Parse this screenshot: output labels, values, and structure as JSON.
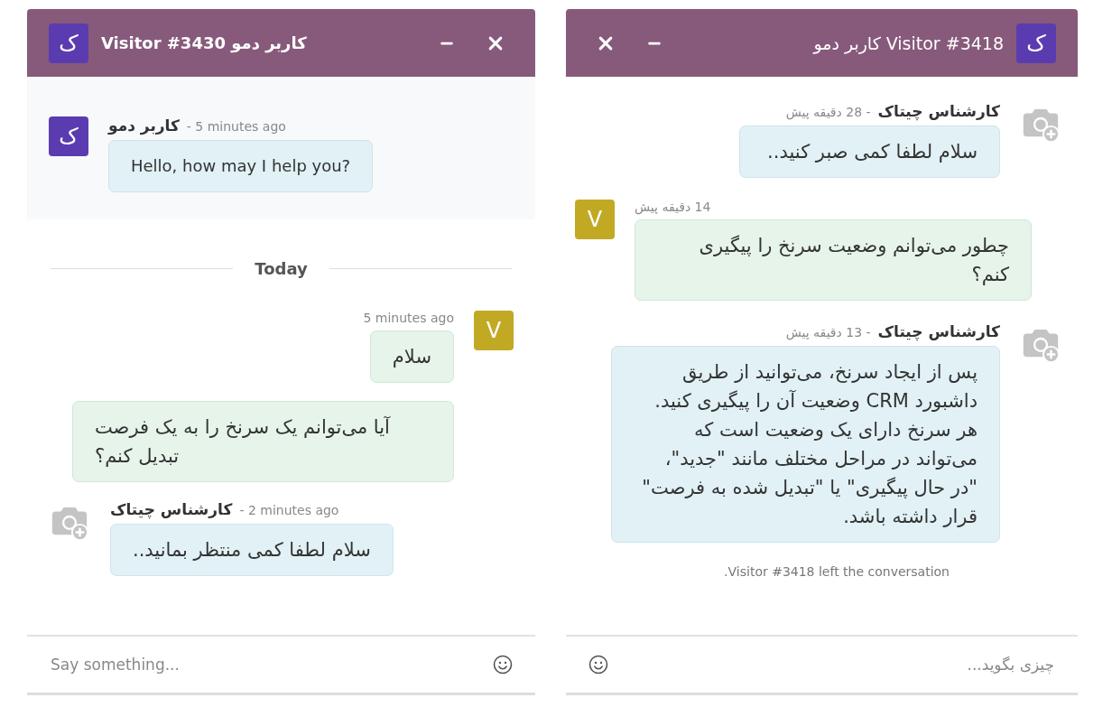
{
  "windows": [
    {
      "kind": "rtl",
      "title": "Visitor #3418 کاربر دمو",
      "avatar": {
        "kind": "letter",
        "letter": "ک",
        "color": "#5b3cb0"
      },
      "thread": [
        {
          "kind": "operator",
          "author": "کارشناس چیتاک",
          "time": "- 28 دقیقه پیش",
          "avatar": {
            "kind": "camera"
          },
          "text": "سلام لطفا کمی صبر کنید.."
        },
        {
          "kind": "visitor",
          "time": "14 دقیقه پیش",
          "avatar": {
            "kind": "letter",
            "letter": "V",
            "color": "#c2a924"
          },
          "text": "چطور می‌توانم وضعیت سرنخ را پیگیری کنم؟"
        },
        {
          "kind": "operator",
          "author": "کارشناس چیتاک",
          "time": "- 13 دقیقه پیش",
          "avatar": {
            "kind": "camera"
          },
          "text": "پس از ایجاد سرنخ، می‌توانید از طریق داشبورد CRM وضعیت آن را پیگیری کنید. هر سرنخ دارای یک وضعیت است که می‌تواند در مراحل مختلف مانند \"جدید\"، \"در حال پیگیری\" یا \"تبدیل شده به فرصت\" قرار داشته باشد."
        },
        {
          "kind": "notice",
          "text": "Visitor #3418 left the conversation."
        }
      ],
      "composer": {
        "placeholder": "چیزی بگوید..."
      }
    },
    {
      "kind": "ltr",
      "title": "Visitor #3430 کاربر دمو",
      "avatar": {
        "kind": "letter",
        "letter": "ک",
        "color": "#5b3cb0"
      },
      "thread": [
        {
          "kind": "operator",
          "highlighted": true,
          "author": "کاربر دمو",
          "time": "- 5 minutes ago",
          "avatar": {
            "kind": "letter",
            "letter": "ک",
            "color": "#5b3cb0"
          },
          "text": "Hello, how may I help you?"
        },
        {
          "kind": "divider",
          "label": "Today"
        },
        {
          "kind": "visitor",
          "highlighted": false,
          "time": "5 minutes ago",
          "avatar": {
            "kind": "letter",
            "letter": "V",
            "color": "#c2a924"
          },
          "text": "سلام"
        },
        {
          "kind": "visitor",
          "highlighted": false,
          "text": "آیا می‌توانم یک سرنخ را به یک فرصت تبدیل کنم؟"
        },
        {
          "kind": "operator",
          "highlighted": false,
          "author": "کارشناس چیتاک",
          "time": "- 2 minutes ago",
          "avatar": {
            "kind": "camera"
          },
          "text": "سلام لطفا کمی منتظر بمانید.."
        }
      ],
      "composer": {
        "placeholder": "Say something..."
      }
    }
  ]
}
